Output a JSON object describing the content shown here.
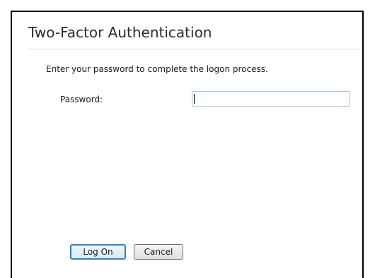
{
  "dialog": {
    "title": "Two-Factor Authentication",
    "instructions": "Enter your password to complete the logon process.",
    "password_label": "Password:",
    "password_value": "",
    "logon_label": "Log On",
    "cancel_label": "Cancel"
  },
  "colors": {
    "title_text": "#2b2b2b",
    "frame_border": "#000000",
    "input_border": "#9fbfe3",
    "default_button_border": "#3c7fb1"
  }
}
